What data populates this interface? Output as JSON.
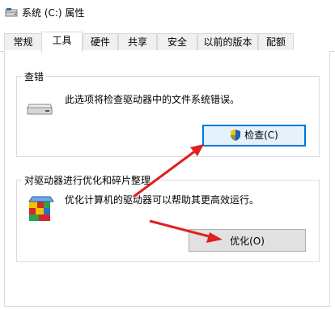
{
  "window": {
    "title": "系统 (C:) 属性"
  },
  "tabs": [
    {
      "label": "常规"
    },
    {
      "label": "工具"
    },
    {
      "label": "硬件"
    },
    {
      "label": "共享"
    },
    {
      "label": "安全"
    },
    {
      "label": "以前的版本"
    },
    {
      "label": "配额"
    }
  ],
  "active_tab": "工具",
  "error_check": {
    "group_title": "查错",
    "description": "此选项将检查驱动器中的文件系统错误。",
    "button_label": "检查(C)",
    "icon": "drive-icon"
  },
  "optimize": {
    "group_title": "对驱动器进行优化和碎片整理",
    "description": "优化计算机的驱动器可以帮助其更高效运行。",
    "button_label": "优化(O)",
    "icon": "defrag-icon"
  },
  "colors": {
    "accent": "#0078d7",
    "annotation_arrow": "#e02020"
  }
}
